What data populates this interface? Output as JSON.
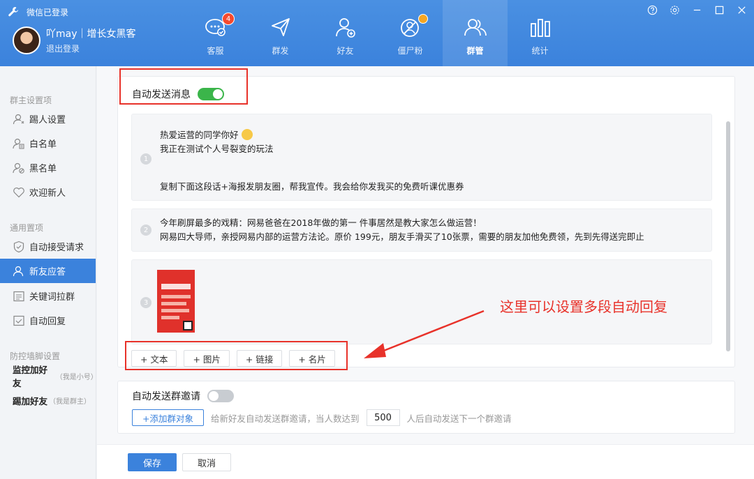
{
  "header": {
    "app_title": "微信已登录",
    "user_name": "吖may｜增长女黑客",
    "logout": "退出登录",
    "nav": [
      {
        "label": "客服",
        "icon": "chat-icon",
        "badge": "4"
      },
      {
        "label": "群发",
        "icon": "send-icon"
      },
      {
        "label": "好友",
        "icon": "add-friend-icon"
      },
      {
        "label": "僵尸粉",
        "icon": "zombie-icon"
      },
      {
        "label": "群管",
        "icon": "group-icon",
        "active": true
      },
      {
        "label": "统计",
        "icon": "stats-icon"
      }
    ],
    "window_controls": [
      "help-icon",
      "settings-icon",
      "minimize-icon",
      "maximize-icon",
      "close-icon"
    ]
  },
  "sidebar": {
    "sections": [
      {
        "title": "群主设置项",
        "items": [
          "踢人设置",
          "白名单",
          "黑名单",
          "欢迎新人"
        ]
      },
      {
        "title": "通用置项",
        "items": [
          "自动接受请求",
          "新友应答",
          "关键词拉群",
          "自动回复"
        ]
      },
      {
        "title": "防控墙脚设置",
        "items": []
      }
    ],
    "active_item": "新友应答",
    "bold_items": [
      {
        "label": "监控加好友",
        "note": "（我是小号）"
      },
      {
        "label": "踢加好友",
        "note": "（我是群主）"
      }
    ]
  },
  "main": {
    "auto_send_label": "自动发送消息",
    "auto_send_on": true,
    "messages": [
      {
        "num": "1",
        "lines": [
          "热爱运营的同学你好",
          "我正在测试个人号裂变的玩法",
          "",
          "复制下面这段话+海报发朋友圈，帮我宣传。我会给你发我买的免费听课优惠券"
        ]
      },
      {
        "num": "2",
        "lines": [
          "今年刷屏最多的戏精：网易爸爸在2018年做的第一 件事居然是教大家怎么做运营！",
          "网易四大导师，亲授网易内部的运营方法论。原价 199元，朋友手滑买了10张票，需要的朋友加他免费领，先到先得送完即止"
        ]
      },
      {
        "num": "3",
        "type": "image"
      }
    ],
    "add_buttons": [
      "+ 文本",
      "+ 图片",
      "+ 链接",
      "+ 名片"
    ],
    "annotation": "这里可以设置多段自动回复",
    "invite_label": "自动发送群邀请",
    "invite_on": false,
    "add_group_button": "+添加群对象",
    "invite_text_before": "给新好友自动发送群邀请，当人数达到",
    "invite_count": "500",
    "invite_text_after": "人后自动发送下一个群邀请",
    "save": "保存",
    "cancel": "取消"
  },
  "colors": {
    "header_blue": "#3b82dc",
    "toggle_on": "#3bb54a",
    "badge_red": "#f5492e",
    "annotation_red": "#e8322a"
  }
}
